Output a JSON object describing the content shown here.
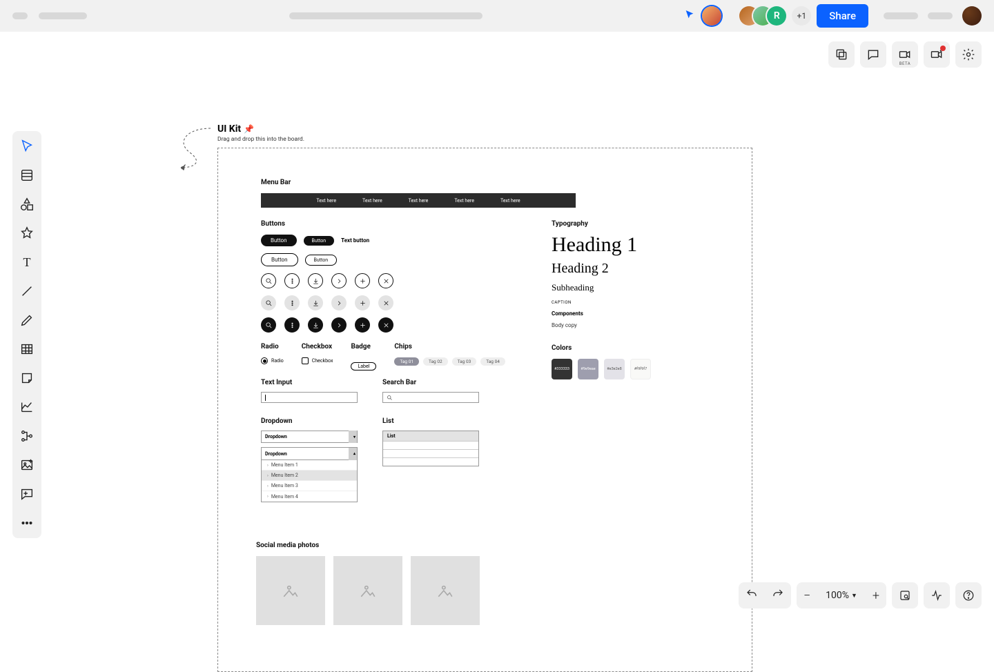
{
  "topbar": {
    "more_users": "+1",
    "share": "Share",
    "avatar_initial": "R"
  },
  "right_strip": {
    "beta": "BETA"
  },
  "kit": {
    "title": "UI Kit",
    "subtitle": "Drag and drop this into the board.",
    "menu": {
      "label": "Menu Bar",
      "items": [
        "Text here",
        "Text here",
        "Text here",
        "Text here",
        "Text here"
      ]
    },
    "buttons": {
      "label": "Buttons",
      "btn": "Button",
      "text_button": "Text button"
    },
    "forms": {
      "radio_label": "Radio",
      "radio": "Radio",
      "checkbox_label": "Checkbox",
      "checkbox": "Checkbox",
      "badge_label": "Badge",
      "badge": "Label",
      "chips_label": "Chips",
      "chips": [
        "Tag 01",
        "Tag 02",
        "Tag 03",
        "Tag 04"
      ]
    },
    "text_input": {
      "label": "Text Input"
    },
    "search": {
      "label": "Search Bar"
    },
    "dropdown": {
      "label": "Dropdown",
      "closed": "Dropdown",
      "open": "Dropdown",
      "items": [
        "Menu Item 1",
        "Menu Item 2",
        "Menu Item 3",
        "Menu Item 4"
      ]
    },
    "list": {
      "label": "List",
      "header": "List"
    },
    "typo": {
      "label": "Typography",
      "h1": "Heading 1",
      "h2": "Heading 2",
      "sub": "Subheading",
      "caption": "CAPTION",
      "components": "Components",
      "body": "Body copy"
    },
    "colors": {
      "label": "Colors",
      "swatches": [
        "#333333",
        "#9e9eae",
        "#e3e2e8",
        "#f9f9f7"
      ]
    },
    "social": {
      "label": "Social media photos"
    }
  },
  "bottom": {
    "zoom": "100%"
  }
}
